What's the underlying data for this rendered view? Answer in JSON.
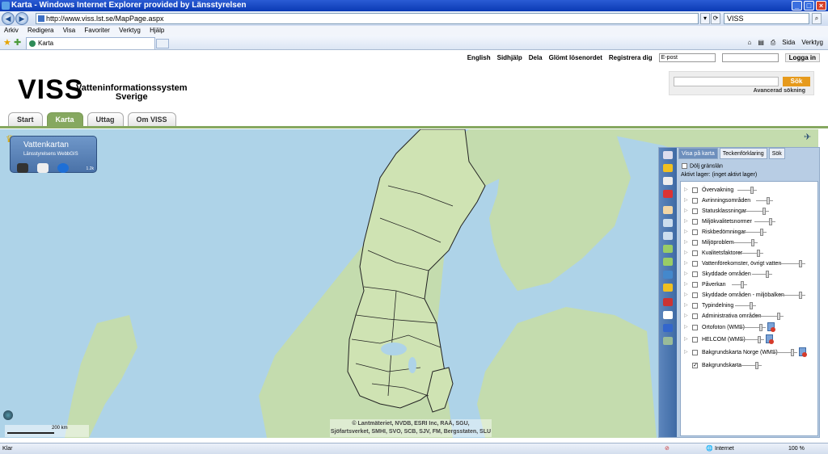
{
  "window": {
    "title": "Karta - Windows Internet Explorer provided by Länsstyrelsen"
  },
  "browser": {
    "url": "http://www.viss.lst.se/MapPage.aspx",
    "search_value": "VISS",
    "menu": [
      "Arkiv",
      "Redigera",
      "Visa",
      "Favoriter",
      "Verktyg",
      "Hjälp"
    ],
    "tab_title": "Karta",
    "tools": [
      "Sida",
      "Verktyg"
    ]
  },
  "site": {
    "top_links": [
      "English",
      "Sidhjälp",
      "Dela",
      "Glömt lösenordet",
      "Registrera dig"
    ],
    "email_placeholder": "E-post",
    "login": "Logga in",
    "logo": "VISS",
    "subtitle_line1": "Vatteninformationssystem",
    "subtitle_line2": "Sverige",
    "search_button": "Sök",
    "advanced_search": "Avancerad sökning",
    "nav_tabs": [
      "Start",
      "Karta",
      "Uttag",
      "Om VISS"
    ],
    "active_tab": "Karta"
  },
  "map": {
    "widget_title": "Vattenkartan",
    "widget_subtitle": "Länsstyrelsens WebbGIS",
    "widget_version": "1.2k",
    "scale_label": "200 km",
    "copyright_line1": "© Lantmäteriet, NVDB, ESRI Inc, RAÄ, SGU,",
    "copyright_line2": "Sjöfartsverket, SMHI, SVO, SCB, SJV, FM, Bergsstaten, SLU"
  },
  "panel": {
    "tabs": [
      "Visa på karta",
      "Teckenförklaring",
      "Sök"
    ],
    "hide_borders": "Dölj gränslän",
    "active_layer": "Aktivt lager: (inget aktivt lager)",
    "layers": [
      {
        "name": "Övervakning",
        "checked": false
      },
      {
        "name": "Avrinningsområden",
        "checked": false
      },
      {
        "name": "Statusklassningar",
        "checked": false
      },
      {
        "name": "Miljökvalitetsnormer",
        "checked": false
      },
      {
        "name": "Riskbedömningar",
        "checked": false
      },
      {
        "name": "Miljöproblem",
        "checked": false
      },
      {
        "name": "Kvalitetsfaktorer",
        "checked": false
      },
      {
        "name": "Vattenförekomster, övrigt vatten",
        "checked": false
      },
      {
        "name": "Skyddade områden",
        "checked": false
      },
      {
        "name": "Påverkan",
        "checked": false
      },
      {
        "name": "Skyddade områden - miljöbalken",
        "checked": false
      },
      {
        "name": "Typindelning",
        "checked": false
      },
      {
        "name": "Administrativa områden",
        "checked": false
      },
      {
        "name": "Ortofoton (WMS)",
        "checked": false
      },
      {
        "name": "HELCOM (WMS)",
        "checked": false
      },
      {
        "name": "Bakgrundskarta Norge (WMS)",
        "checked": false
      },
      {
        "name": "Bakgrundskarta",
        "checked": true
      }
    ]
  },
  "status": {
    "left": "Klar",
    "zone": "Internet",
    "zoom": "100 %"
  }
}
